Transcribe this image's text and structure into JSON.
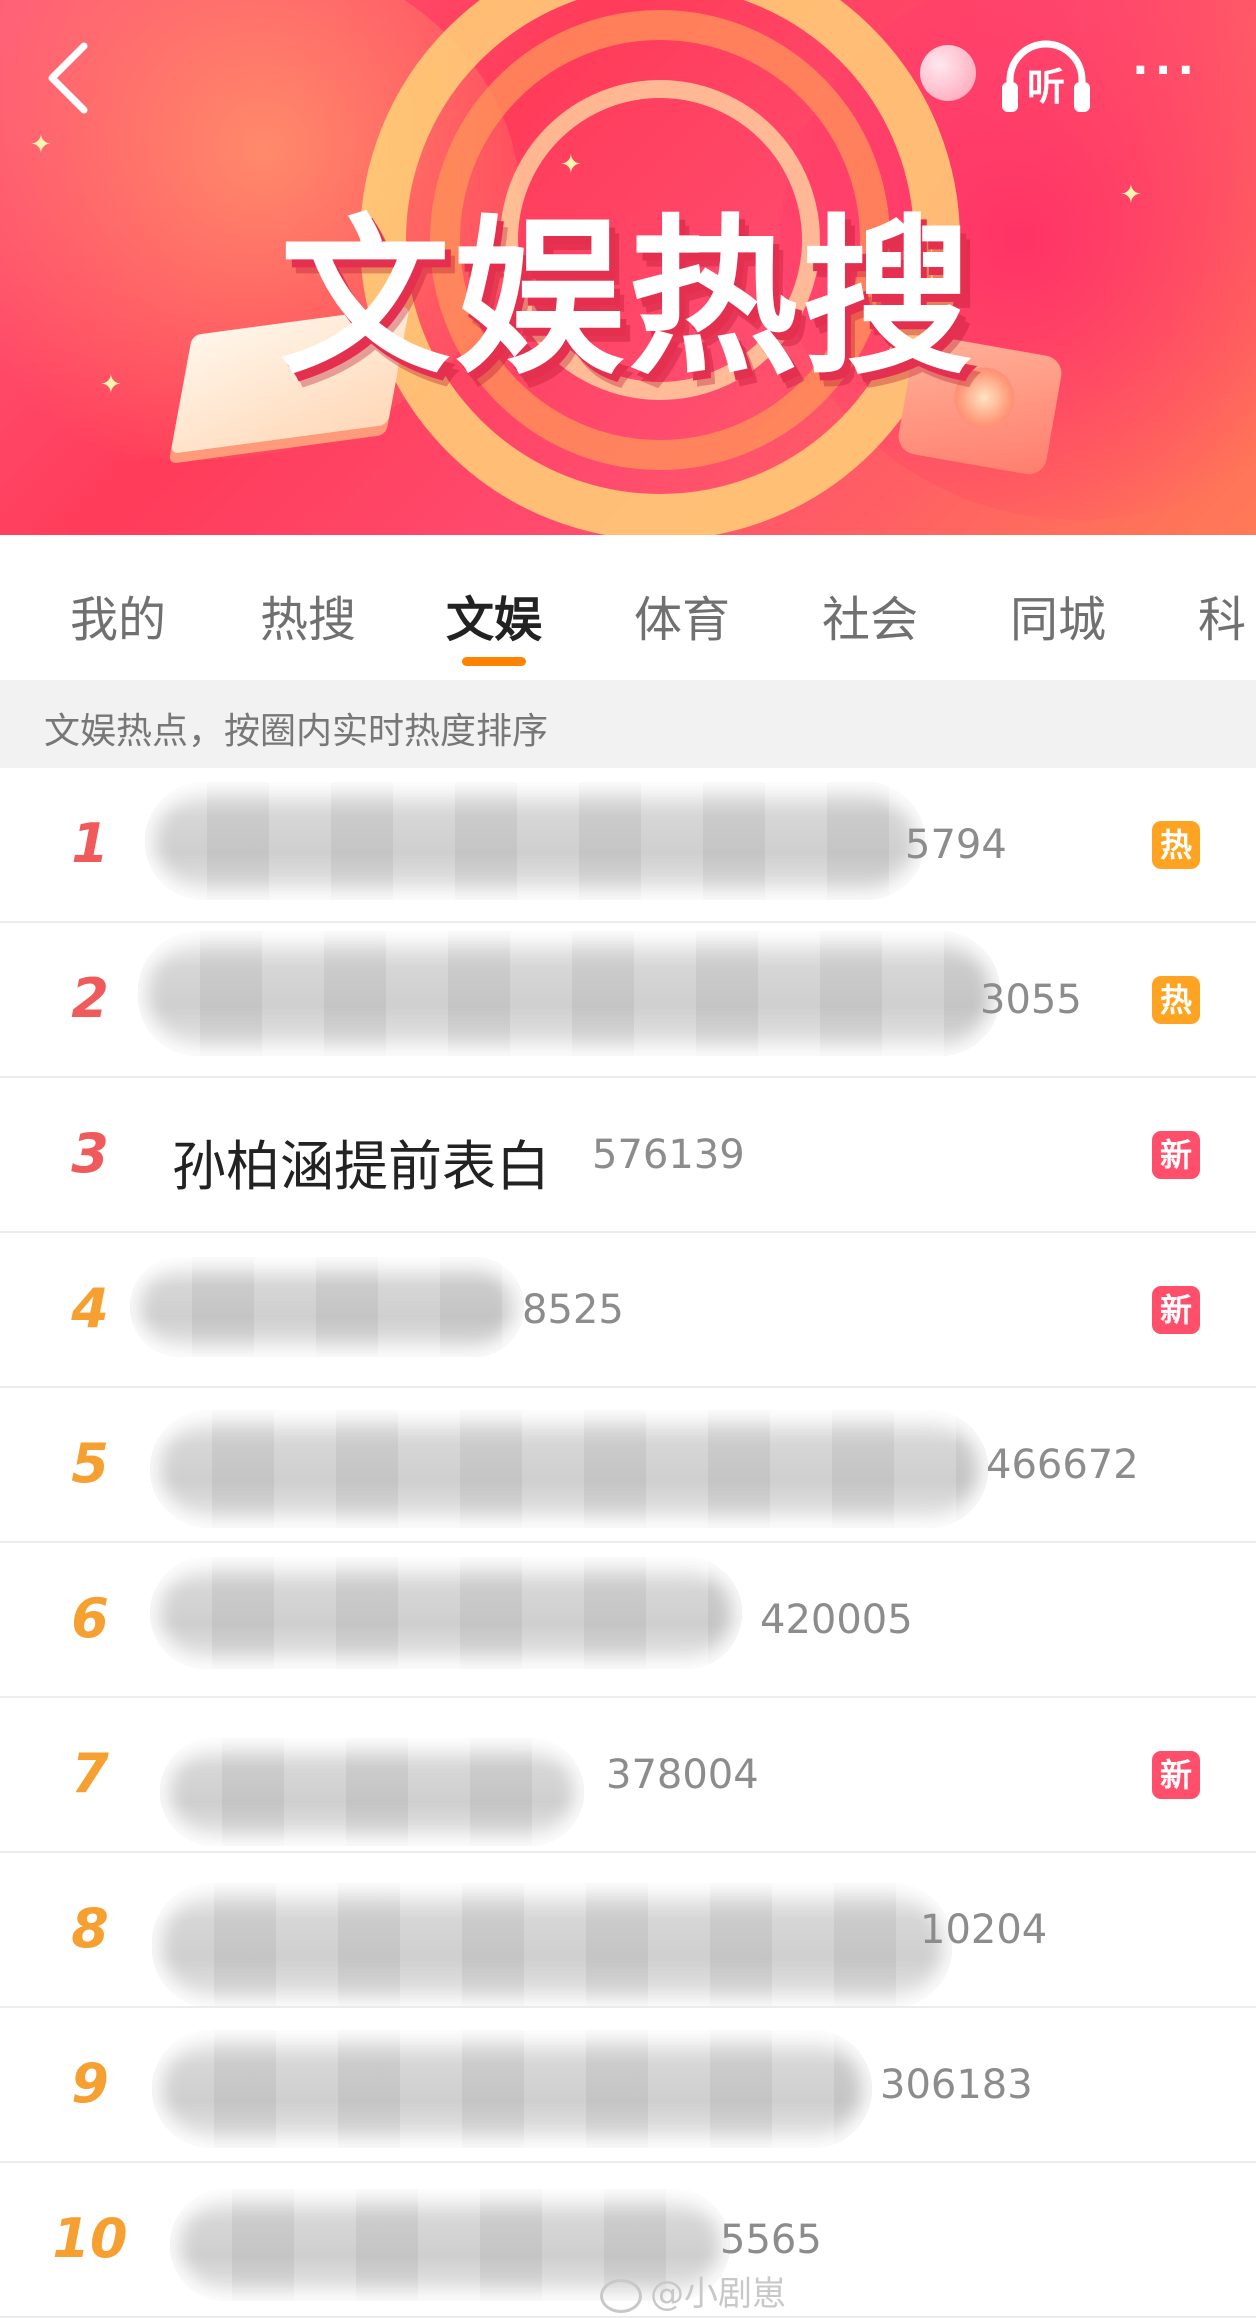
{
  "banner": {
    "title": "文娱热搜",
    "listen_label": "听",
    "more_label": "···"
  },
  "tabs": [
    {
      "label": "我的"
    },
    {
      "label": "热搜"
    },
    {
      "label": "文娱",
      "active": true
    },
    {
      "label": "体育"
    },
    {
      "label": "社会"
    },
    {
      "label": "同城"
    },
    {
      "label": "科"
    }
  ],
  "hint": "文娱热点，按圈内实时热度排序",
  "list": [
    {
      "rank": "1",
      "title": "",
      "heat": "5794",
      "badge": "热",
      "badge_type": "hot"
    },
    {
      "rank": "2",
      "title": "",
      "heat": "3055",
      "badge": "热",
      "badge_type": "hot"
    },
    {
      "rank": "3",
      "title": "孙柏涵提前表白",
      "heat": "576139",
      "badge": "新",
      "badge_type": "new"
    },
    {
      "rank": "4",
      "title": "",
      "heat": "8525",
      "badge": "新",
      "badge_type": "new"
    },
    {
      "rank": "5",
      "title": "",
      "heat": "466672",
      "badge": "",
      "badge_type": ""
    },
    {
      "rank": "6",
      "title": "",
      "heat": "420005",
      "badge": "",
      "badge_type": ""
    },
    {
      "rank": "7",
      "title": "",
      "heat": "378004",
      "badge": "新",
      "badge_type": "new"
    },
    {
      "rank": "8",
      "title": "",
      "heat": "10204",
      "badge": "",
      "badge_type": ""
    },
    {
      "rank": "9",
      "title": "",
      "heat": "306183",
      "badge": "",
      "badge_type": ""
    },
    {
      "rank": "10",
      "title": "",
      "heat": "5565",
      "badge": "",
      "badge_type": ""
    }
  ],
  "watermark": "@小剧崽",
  "colors": {
    "accent": "#ff8200",
    "rank_top": "#f05a5a",
    "rank_mid": "#f5a030",
    "badge_hot": "#ffa422",
    "badge_new": "#ff4f6b"
  },
  "icons": [
    "back-icon",
    "headphones-icon",
    "more-icon",
    "weibo-icon"
  ]
}
